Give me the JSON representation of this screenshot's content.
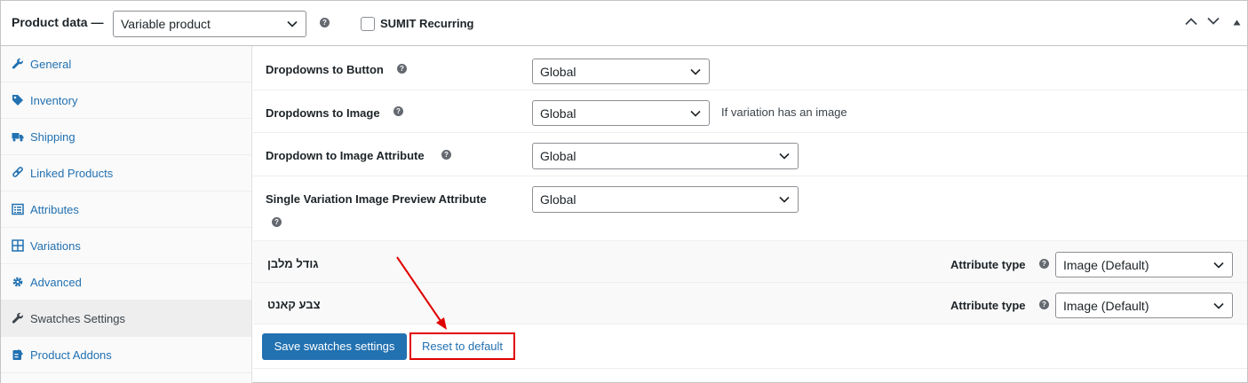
{
  "header": {
    "title": "Product data —",
    "product_type": "Variable product",
    "help": "?",
    "recurring_label": "SUMIT Recurring"
  },
  "sidebar": {
    "items": [
      {
        "label": "General",
        "icon": "wrench-icon"
      },
      {
        "label": "Inventory",
        "icon": "tag-icon"
      },
      {
        "label": "Shipping",
        "icon": "truck-icon"
      },
      {
        "label": "Linked Products",
        "icon": "link-icon"
      },
      {
        "label": "Attributes",
        "icon": "list-icon"
      },
      {
        "label": "Variations",
        "icon": "grid-icon"
      },
      {
        "label": "Advanced",
        "icon": "gear-icon"
      },
      {
        "label": "Swatches Settings",
        "icon": "wrench-icon",
        "active": true
      },
      {
        "label": "Product Addons",
        "icon": "addon-icon"
      }
    ]
  },
  "settings": {
    "dropdowns_to_button": {
      "label": "Dropdowns to Button",
      "value": "Global"
    },
    "dropdowns_to_image": {
      "label": "Dropdowns to Image",
      "value": "Global",
      "note": "If variation has an image"
    },
    "dropdown_to_image_attribute": {
      "label": "Dropdown to Image Attribute",
      "value": "Global"
    },
    "single_variation_preview": {
      "label": "Single Variation Image Preview Attribute",
      "value": "Global"
    }
  },
  "attributes": [
    {
      "name": "גודל מלבן",
      "type_label": "Attribute type",
      "value": "Image (Default)"
    },
    {
      "name": "צבע קאנט",
      "type_label": "Attribute type",
      "value": "Image (Default)"
    }
  ],
  "actions": {
    "save": "Save swatches settings",
    "reset": "Reset to default"
  },
  "colors": {
    "link": "#2271b1",
    "primary": "#2271b1",
    "highlight": "#e00000"
  }
}
